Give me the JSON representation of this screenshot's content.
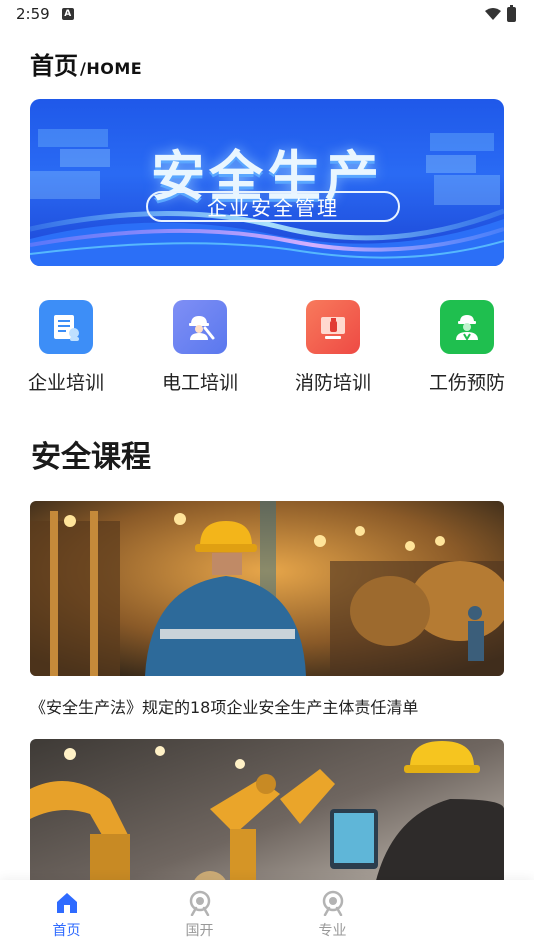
{
  "status_bar": {
    "time": "2:59",
    "notification_icon": "A"
  },
  "header": {
    "title": "首页",
    "title_en": "/HOME"
  },
  "banner": {
    "title": "安全生产",
    "subtitle": "企业安全管理"
  },
  "categories": [
    {
      "label": "企业培训",
      "icon": "document-icon",
      "color": "#3d8ef7"
    },
    {
      "label": "电工培训",
      "icon": "electrician-icon",
      "color": "#6e88f2"
    },
    {
      "label": "消防培训",
      "icon": "fire-extinguisher-icon",
      "color": "#f0584a"
    },
    {
      "label": "工伤预防",
      "icon": "worker-icon",
      "color": "#1fbf4f"
    }
  ],
  "section": {
    "title": "安全课程"
  },
  "courses": [
    {
      "title": "《安全生产法》规定的18项企业安全生产主体责任清单"
    },
    {
      "title": ""
    }
  ],
  "tabs": [
    {
      "label": "首页",
      "icon": "home-icon",
      "active": true
    },
    {
      "label": "国开",
      "icon": "target-icon",
      "active": false
    },
    {
      "label": "专业",
      "icon": "target-icon",
      "active": false
    }
  ],
  "colors": {
    "accent": "#2f6bff",
    "banner_blue": "#1f57e8"
  }
}
